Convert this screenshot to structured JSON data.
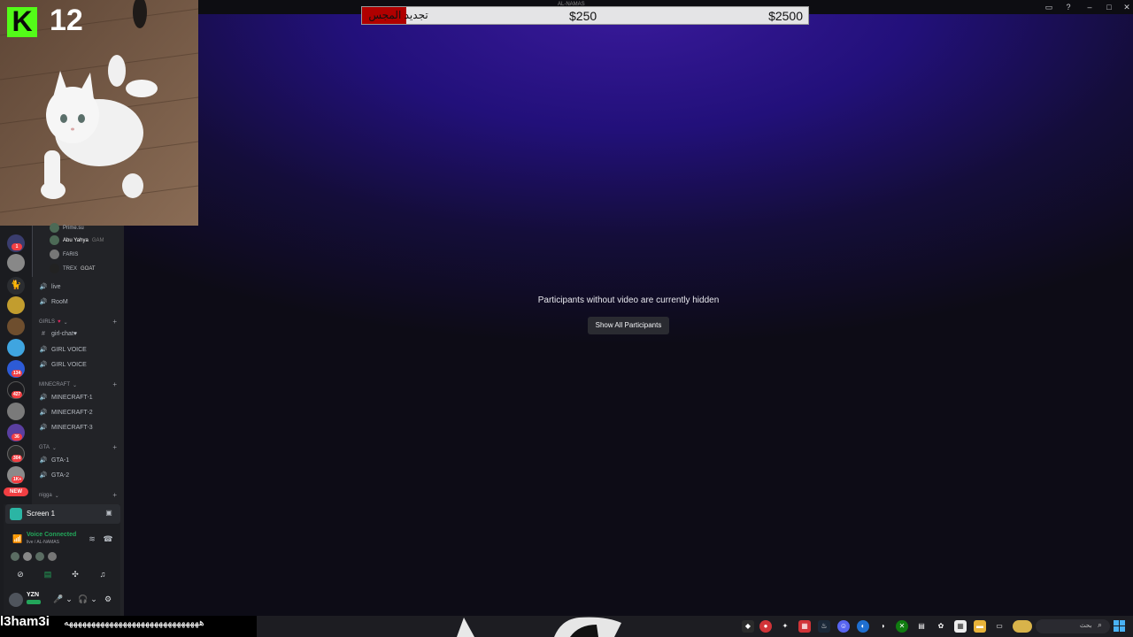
{
  "window": {
    "title": "AL-NAMAS"
  },
  "donation_bar": {
    "label": "تجديد المجس",
    "current": "$250",
    "goal": "$2500",
    "progress_fraction": 0.1,
    "fill_color": "#b00000"
  },
  "webcam": {
    "kick_logo": "K",
    "viewer_count": "12",
    "accent_color": "#53fc18"
  },
  "stage": {
    "hidden_message": "Participants without video are currently hidden",
    "show_all_label": "Show All Participants"
  },
  "server_rail": {
    "badges": [
      "1",
      "134",
      "427",
      "36",
      "304",
      "1K+"
    ],
    "new_label": "NEW"
  },
  "channel_list": {
    "voice_users": [
      {
        "name": "Prime.su",
        "tag": ""
      },
      {
        "name": "Abu Yahya",
        "tag": "GAM"
      },
      {
        "name": "FARIS",
        "tag": ""
      },
      {
        "name": "TREX",
        "tag": "GOAT"
      }
    ],
    "ungrouped": [
      {
        "name": "live",
        "icon": "speaker-icon"
      },
      {
        "name": "RooM",
        "icon": "speaker-icon"
      }
    ],
    "categories": [
      {
        "name": "GIRLS",
        "emoji": "♥",
        "channels": [
          {
            "name": "girl-chat♥",
            "icon": "hash-icon"
          },
          {
            "name": "GIRL VOICE",
            "icon": "speaker-icon"
          },
          {
            "name": "GIRL VOICE",
            "icon": "speaker-icon"
          }
        ]
      },
      {
        "name": "MINECRAFT",
        "emoji": "",
        "channels": [
          {
            "name": "MINECRAFT-1",
            "icon": "speaker-icon"
          },
          {
            "name": "MINECRAFT-2",
            "icon": "speaker-icon"
          },
          {
            "name": "MINECRAFT-3",
            "icon": "speaker-icon"
          }
        ]
      },
      {
        "name": "GTA",
        "emoji": "",
        "channels": [
          {
            "name": "GTA-1",
            "icon": "speaker-icon"
          },
          {
            "name": "GTA-2",
            "icon": "speaker-icon"
          }
        ]
      },
      {
        "name": "nigga",
        "emoji": "",
        "channels": []
      }
    ]
  },
  "voice_panel": {
    "screen_label": "Screen 1",
    "status": "Voice Connected",
    "location": "live / AL-NAMAS",
    "status_color": "#23a55a"
  },
  "user_panel": {
    "username": "YZN"
  },
  "chat_overlay": {
    "username": "l3ham3i",
    "message": "ههههههههههههههههههههههههههههههه"
  },
  "taskbar": {
    "search_label": "بحث"
  }
}
